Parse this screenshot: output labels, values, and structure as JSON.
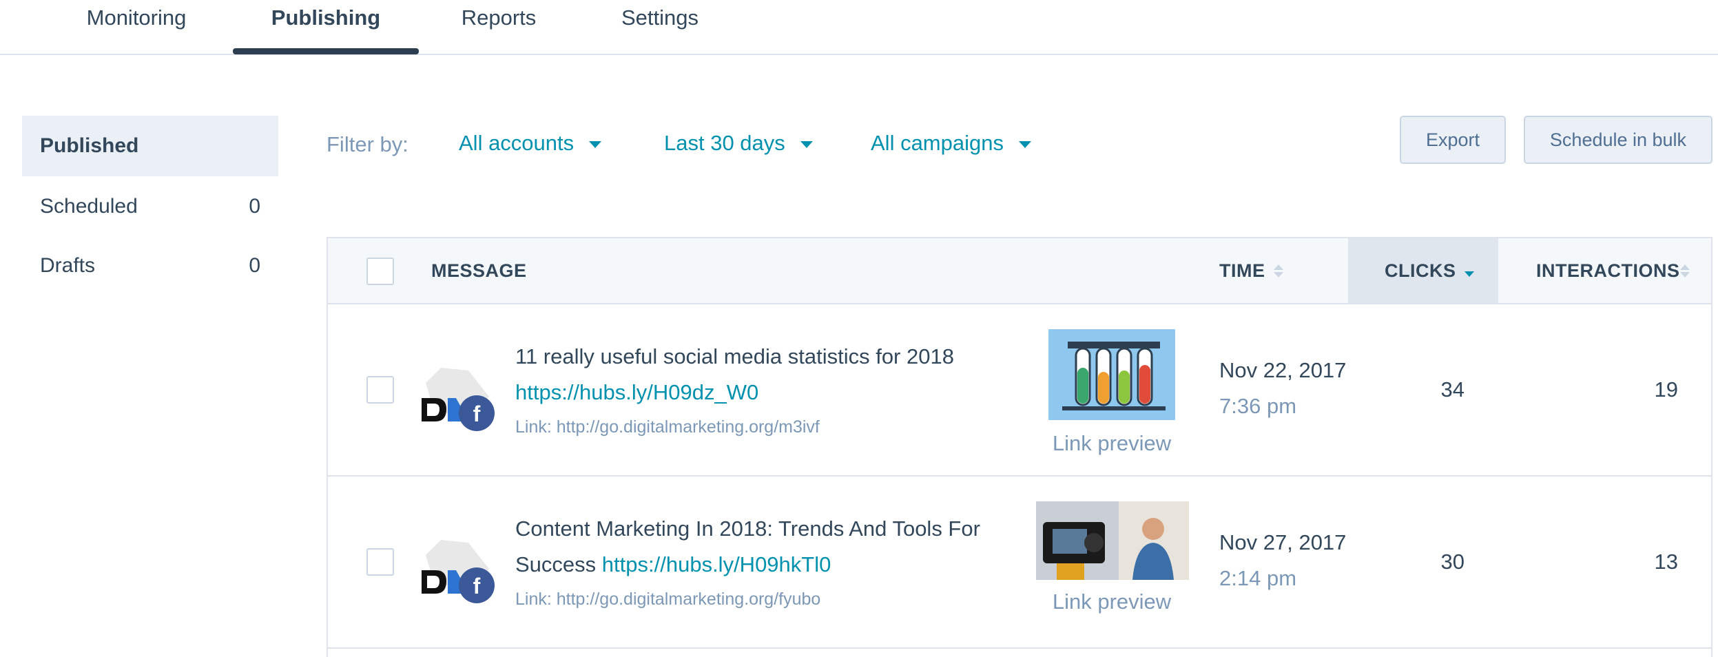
{
  "tabs": [
    "Monitoring",
    "Publishing",
    "Reports",
    "Settings"
  ],
  "sidebar": {
    "items": [
      {
        "label": "Published",
        "count": ""
      },
      {
        "label": "Scheduled",
        "count": "0"
      },
      {
        "label": "Drafts",
        "count": "0"
      }
    ]
  },
  "filters": {
    "label": "Filter by:",
    "accounts": "All accounts",
    "period": "Last 30 days",
    "campaigns": "All campaigns"
  },
  "buttons": {
    "export": "Export",
    "schedule_bulk": "Schedule in bulk"
  },
  "table": {
    "headers": {
      "message": "MESSAGE",
      "time": "TIME",
      "clicks": "CLICKS",
      "interactions": "INTERACTIONS"
    },
    "rows": [
      {
        "title": "11 really useful social media statistics for 2018",
        "short_link": "https://hubs.ly/H09dz_W0",
        "link": "Link: http://go.digitalmarketing.org/m3ivf",
        "preview_label": "Link preview",
        "date": "Nov 22, 2017",
        "time": "7:36 pm",
        "clicks": "34",
        "interactions": "19"
      },
      {
        "title": "Content Marketing In 2018: Trends And Tools For Success",
        "short_link": "https://hubs.ly/H09hkTl0",
        "link": "Link: http://go.digitalmarketing.org/fyubo",
        "preview_label": "Link preview",
        "date": "Nov 27, 2017",
        "time": "2:14 pm",
        "clicks": "30",
        "interactions": "13"
      }
    ]
  },
  "colors": {
    "accent": "#0091ae",
    "text": "#33475b",
    "muted": "#7c98b6",
    "facebook": "#3b5998"
  },
  "icons": [
    "account-avatar-icon",
    "facebook-icon",
    "sort-icon",
    "caret-down-icon"
  ]
}
